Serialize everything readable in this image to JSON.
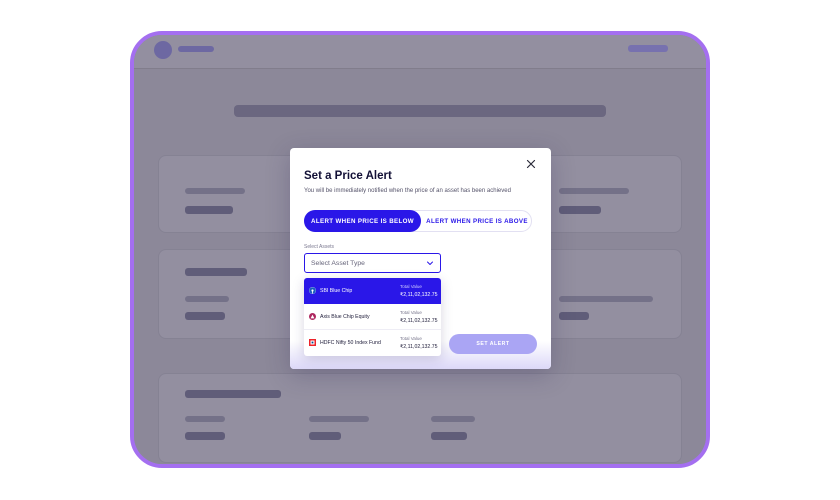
{
  "modal": {
    "title": "Set a Price Alert",
    "subtitle": "You will be immediately notified when the price of an asset has been achieved",
    "close_icon": "close-icon",
    "toggle": {
      "below_label": "ALERT WHEN PRICE IS BELOW",
      "above_label": "ALERT WHEN PRICE IS ABOVE",
      "active": "below"
    },
    "select": {
      "label": "Select Assets",
      "placeholder": "Select Asset Type"
    },
    "options": [
      {
        "name": "SBI Blue Chip",
        "total_value_label": "Total Value",
        "total_value": "₹2,11,02,132.75",
        "selected": true,
        "icon": "sbi-logo-icon"
      },
      {
        "name": "Axis Blue Chip Equity",
        "total_value_label": "Total Value",
        "total_value": "₹2,11,02,132.75",
        "selected": false,
        "icon": "axis-logo-icon"
      },
      {
        "name": "HDFC Nifty 50 Index Fund",
        "total_value_label": "Total Value",
        "total_value": "₹2,11,02,132.75",
        "selected": false,
        "icon": "hdfc-logo-icon"
      }
    ],
    "submit_label": "SET ALERT"
  },
  "colors": {
    "accent": "#2a17e8",
    "device_border": "#a46ff0",
    "submit_disabled": "#aaa5f4"
  }
}
